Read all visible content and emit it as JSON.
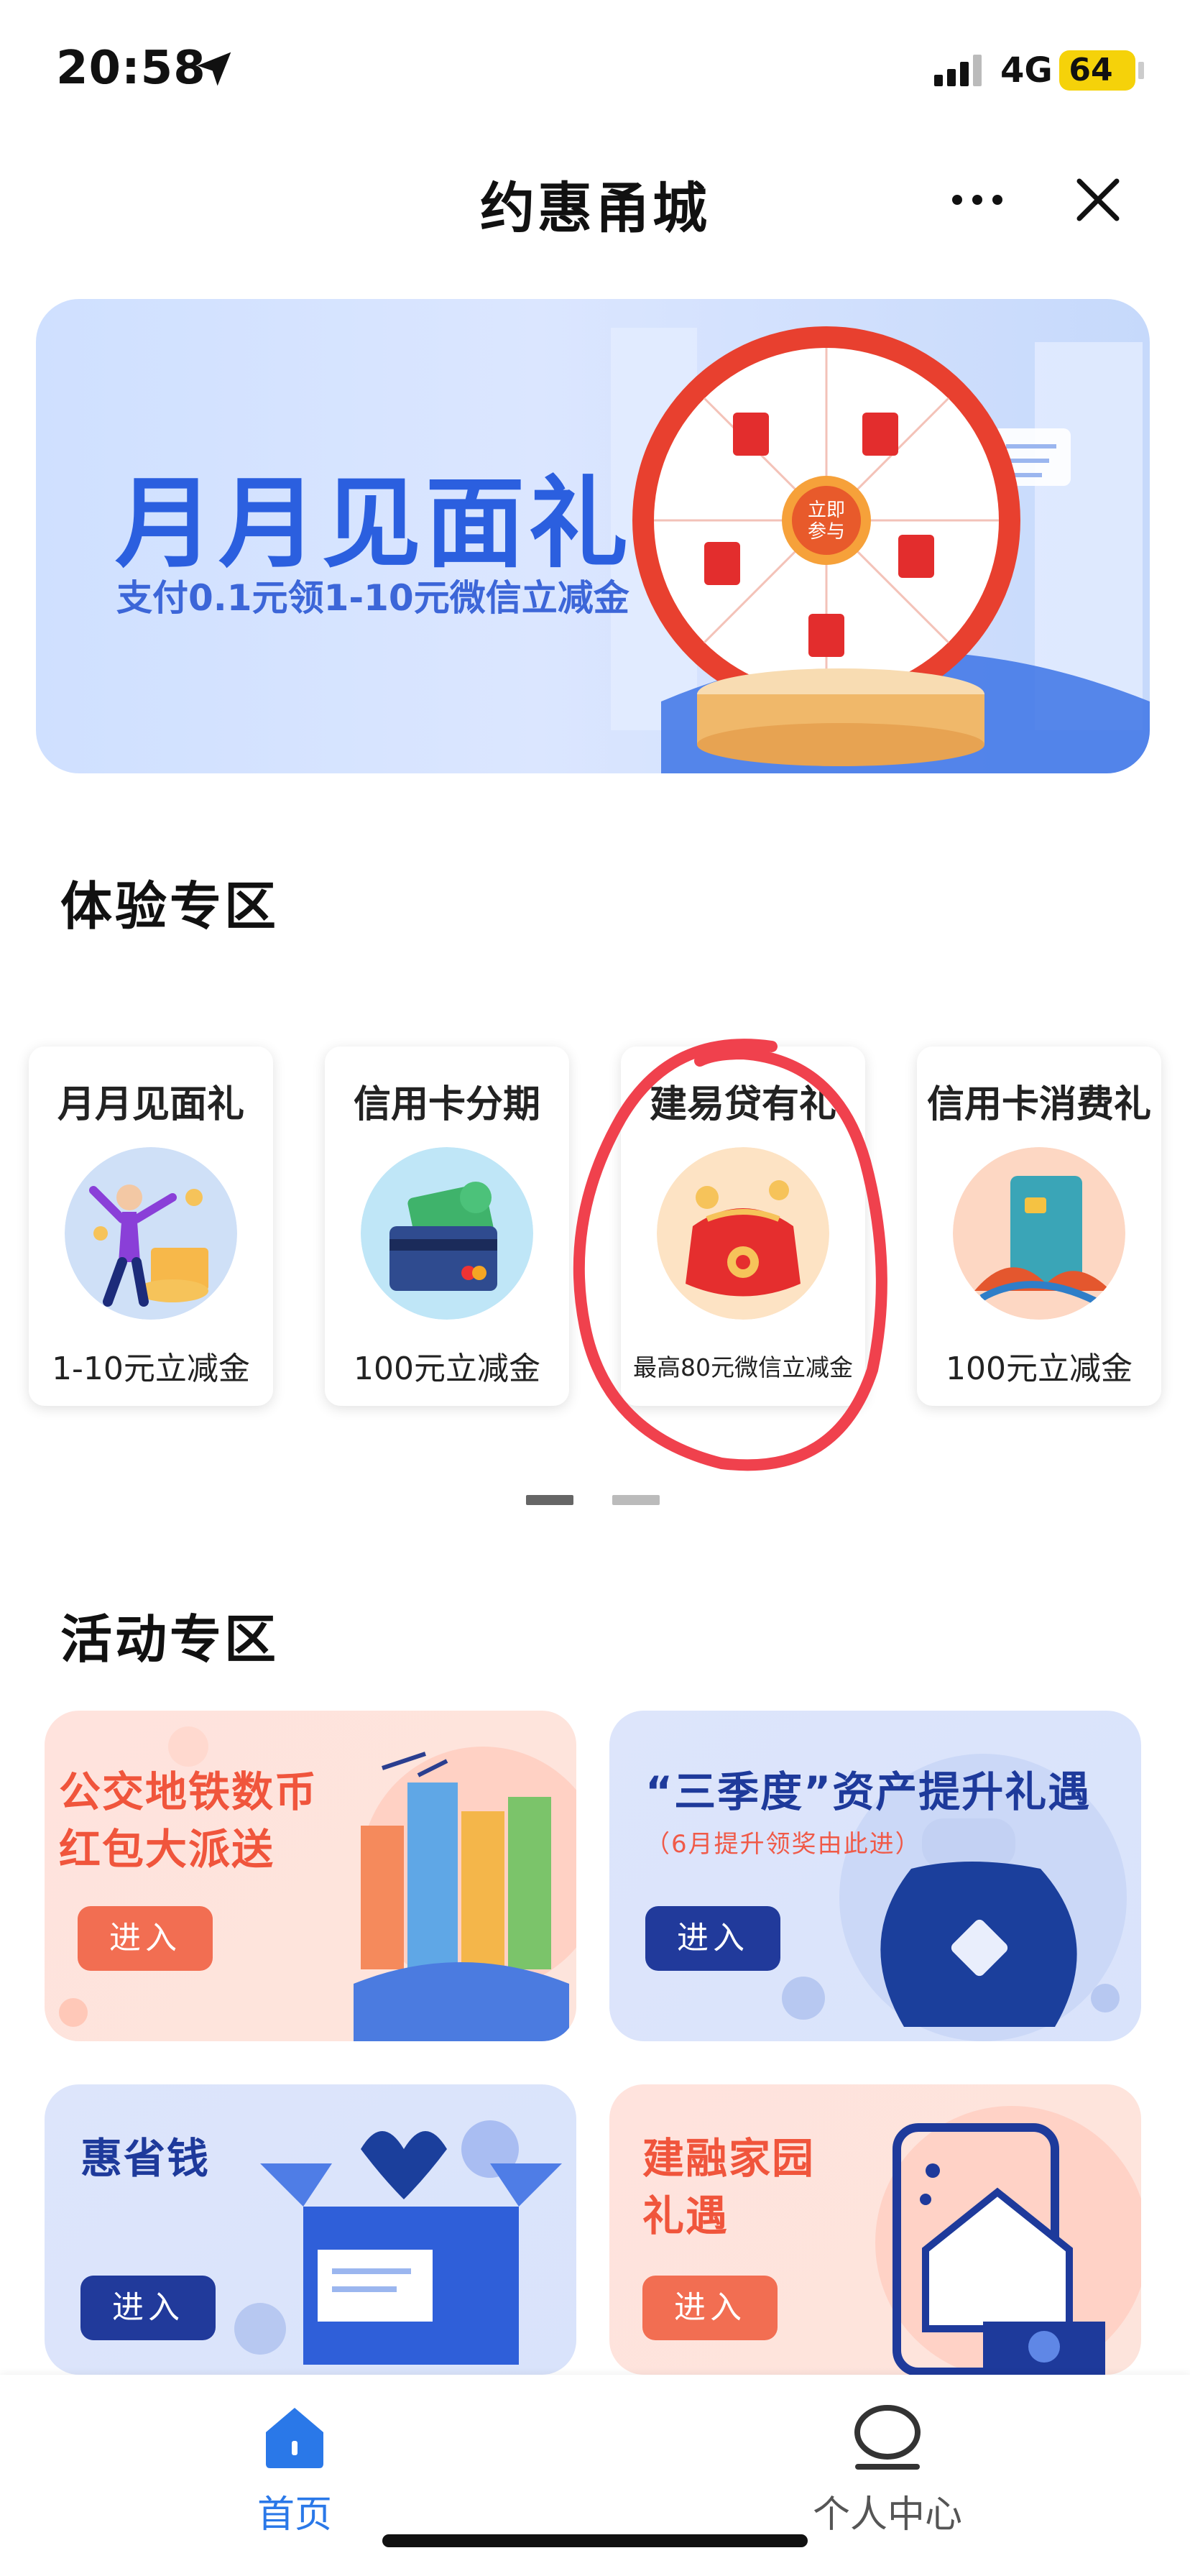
{
  "status_bar": {
    "time": "20:58",
    "network": "4G",
    "battery": "64"
  },
  "header": {
    "title": "约惠甬城"
  },
  "hero": {
    "title": "月月见面礼",
    "subtitle": "支付0.1元领1-10元微信立减金",
    "wheel_center": "立即参与"
  },
  "experience": {
    "title": "体验专区",
    "cards": [
      {
        "title": "月月见面礼",
        "subtitle": "1-10元立减金"
      },
      {
        "title": "信用卡分期",
        "subtitle": "100元立减金"
      },
      {
        "title": "建易贷有礼",
        "subtitle": "最高80元微信立减金"
      },
      {
        "title": "信用卡消费礼",
        "subtitle": "100元立减金"
      }
    ]
  },
  "activity": {
    "title": "活动专区",
    "cards": [
      {
        "title_line1": "公交地铁数币",
        "title_line2": "红包大派送",
        "button": "进入"
      },
      {
        "title_line1": "“三季度”资产提升礼遇",
        "note": "（6月提升领奖由此进）",
        "button": "进入"
      },
      {
        "title_line1": "惠省钱",
        "button": "进入"
      },
      {
        "title_line1": "建融家园",
        "title_line2": "礼遇",
        "button": "进入"
      }
    ]
  },
  "nav": {
    "home": "首页",
    "profile": "个人中心"
  },
  "colors": {
    "accent_blue": "#2a78e8",
    "hero_blue": "#2b5fdf",
    "orange": "#f26e52",
    "navy": "#213a9b",
    "highlight_red": "#f0414d"
  }
}
